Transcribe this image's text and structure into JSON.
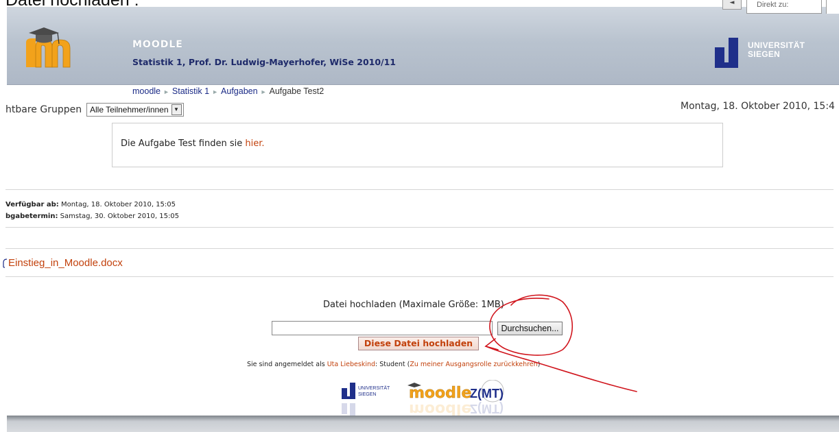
{
  "slide": {
    "title": "Datei hochladen :"
  },
  "header": {
    "site_name": "MOODLE",
    "course_title": "Statistik 1, Prof. Dr. Ludwig-Mayerhofer, WiSe 2010/11",
    "search_placeholder": "Direkt zu:",
    "university_line1": "UNIVERSITÄT",
    "university_line2": "SIEGEN"
  },
  "breadcrumb": {
    "items": [
      "moodle",
      "Statistik 1",
      "Aufgaben"
    ],
    "current": "Aufgabe Test2",
    "separator": "►"
  },
  "groups": {
    "label": "htbare Gruppen",
    "selected": "Alle Teilnehmer/innen"
  },
  "datetime": "Montag, 18. Oktober 2010, 15:4",
  "intro": {
    "text": "Die Aufgabe Test finden sie ",
    "link": "hier."
  },
  "dates": {
    "available_label": "Verfügbar ab:",
    "available_value": "Montag, 18. Oktober 2010, 15:05",
    "due_label": "bgabetermin:",
    "due_value": "Samstag, 30. Oktober 2010, 15:05"
  },
  "attachment": {
    "filename": "Einstieg_in_Moodle.docx"
  },
  "upload": {
    "title": "Datei hochladen (Maximale Größe: 1MB)",
    "browse_label": "Durchsuchen...",
    "submit_label": "Diese Datei hochladen"
  },
  "login": {
    "prefix": "Sie sind angemeldet als ",
    "user": "Uta Liebeskind",
    "role": ": Student (",
    "return_link": "Zu meiner Ausgangsrolle zurückkehren",
    "suffix": ")"
  },
  "footer": {
    "uni_line1": "UNIVERSITÄT",
    "uni_line2": "SIEGEN",
    "moodle": "moodle",
    "zimt": "Z(MT)"
  },
  "colors": {
    "link": "#c2410c",
    "nav": "#1a2a86",
    "annotation": "#d0141c",
    "moodle_orange": "#f2a21b",
    "uni_blue": "#1f2f8a"
  }
}
